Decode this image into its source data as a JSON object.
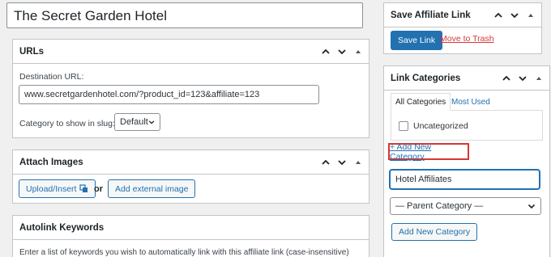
{
  "post_title": "The Secret Garden Hotel",
  "urls_box": {
    "title": "URLs",
    "destination_label": "Destination URL:",
    "destination_value": "www.secretgardenhotel.com/?product_id=123&affiliate=123",
    "category_slug_label": "Category to show in slug:",
    "category_slug_value": "Default"
  },
  "attach_images_box": {
    "title": "Attach Images",
    "upload_button": "Upload/Insert",
    "or_text": "or",
    "external_button": "Add external image"
  },
  "autolink_box": {
    "title": "Autolink Keywords",
    "description": "Enter a list of keywords you wish to automatically link with this affiliate link (case-insensitive)"
  },
  "save_box": {
    "title": "Save Affiliate Link",
    "save_button": "Save Link",
    "trash_link": "Move to Trash"
  },
  "categories_box": {
    "title": "Link Categories",
    "tabs": [
      "All Categories",
      "Most Used"
    ],
    "categories": [
      {
        "label": "Uncategorized",
        "checked": false
      }
    ],
    "add_new_link": "+ Add New Category",
    "new_category_value": "Hotel Affiliates",
    "parent_select_value": "— Parent Category —",
    "add_button": "Add New Category"
  },
  "colors": {
    "accent": "#2271b1",
    "danger": "#d63638",
    "highlight_border": "#d63638"
  }
}
